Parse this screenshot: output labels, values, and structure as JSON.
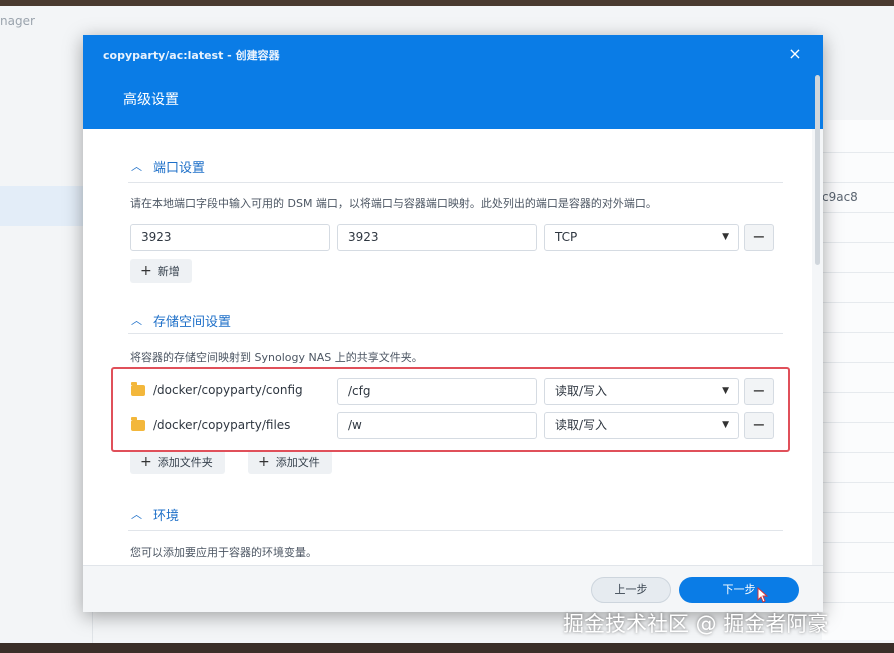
{
  "background_app": {
    "title_fragment": "nager",
    "row_id_fragment": "c9ac8"
  },
  "dialog": {
    "title": "copyparty/ac:latest - 创建容器",
    "subtitle": "高级设置",
    "close_glyph": "×"
  },
  "ports": {
    "section_title": "端口设置",
    "description": "请在本地端口字段中输入可用的 DSM 端口，以将端口与容器端口映射。此处列出的端口是容器的对外端口。",
    "rows": [
      {
        "local_port": "3923",
        "container_port": "3923",
        "protocol": "TCP"
      }
    ],
    "add_label": "新增"
  },
  "storage": {
    "section_title": "存储空间设置",
    "description": "将容器的存储空间映射到 Synology NAS 上的共享文件夹。",
    "rows": [
      {
        "folder": "/docker/copyparty/config",
        "mount_path": "/cfg",
        "permission": "读取/写入"
      },
      {
        "folder": "/docker/copyparty/files",
        "mount_path": "/w",
        "permission": "读取/写入"
      }
    ],
    "add_folder_label": "添加文件夹",
    "add_file_label": "添加文件"
  },
  "environment": {
    "section_title": "环境",
    "description": "您可以添加要应用于容器的环境变量。"
  },
  "footer": {
    "prev_label": "上一步",
    "next_label": "下一步"
  },
  "watermark": "掘金技术社区 @ 掘金者阿豪",
  "colors": {
    "accent": "#0a7ce6",
    "highlight_border": "#e0505a",
    "folder": "#f3b73b"
  },
  "icons": [
    "close-icon",
    "chevron-up-icon",
    "caret-down-icon",
    "minus-icon",
    "plus-icon",
    "folder-icon",
    "cursor-icon"
  ]
}
